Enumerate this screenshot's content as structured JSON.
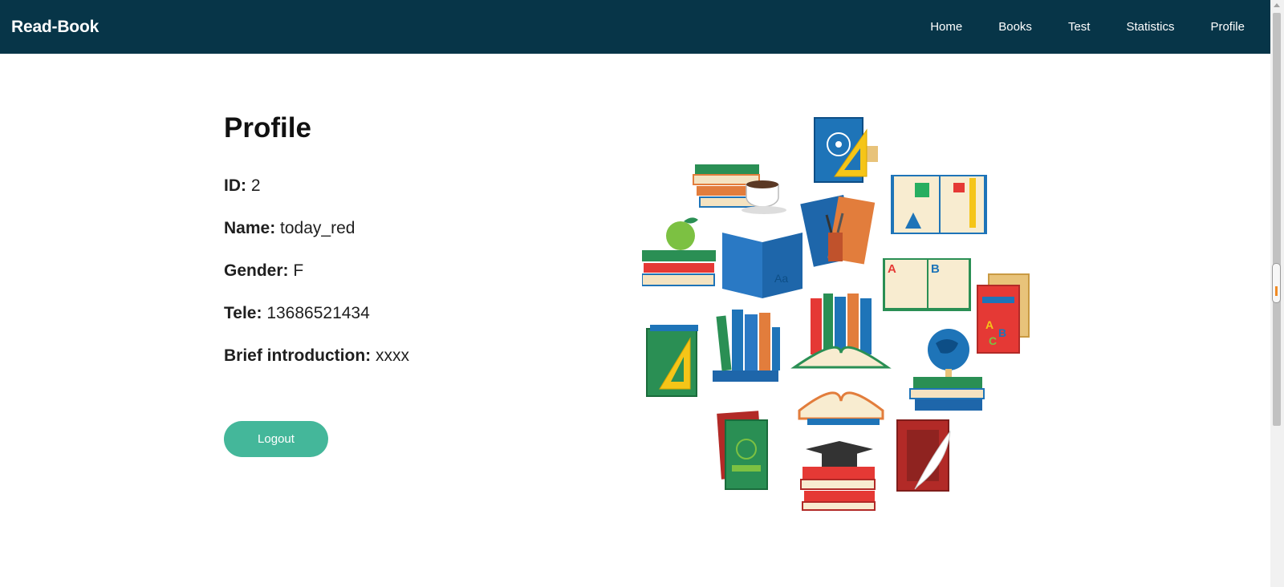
{
  "navbar": {
    "brand": "Read-Book",
    "items": [
      "Home",
      "Books",
      "Test",
      "Statistics",
      "Profile"
    ]
  },
  "profile": {
    "title": "Profile",
    "fields": [
      {
        "label": "ID:",
        "value": "2"
      },
      {
        "label": "Name:",
        "value": "today_red"
      },
      {
        "label": "Gender:",
        "value": "F"
      },
      {
        "label": "Tele:",
        "value": "13686521434"
      },
      {
        "label": "Brief introduction:",
        "value": "xxxx"
      }
    ],
    "logout_label": "Logout"
  },
  "illustration": {
    "icon": "books-collage-illustration",
    "letters": [
      "Aa",
      "A",
      "B",
      "A",
      "B",
      "C"
    ]
  },
  "colors": {
    "navbar_bg": "#073548",
    "accent": "#44b79a",
    "text": "#1f1f1f"
  }
}
